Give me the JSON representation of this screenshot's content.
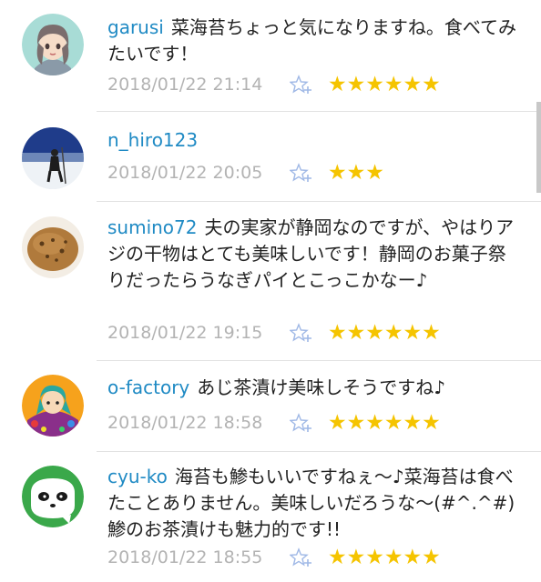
{
  "comments": [
    {
      "username": "garusi",
      "text": "菜海苔ちょっと気になりますね。食べてみたいです！",
      "timestamp": "2018/01/22 21:14",
      "stars": "★★★★★★",
      "avatar_icon": "anime-girl-avatar-icon"
    },
    {
      "username": "n_hiro123",
      "text": "",
      "timestamp": "2018/01/22 20:05",
      "stars": "★★★",
      "avatar_icon": "snow-hiker-avatar-icon"
    },
    {
      "username": "sumino72",
      "text": "夫の実家が静岡なのですが、やはりアジの干物はとても美味しいです！静岡のお菓子祭りだったらうなぎパイとこっこかなー♪",
      "timestamp": "2018/01/22 19:15",
      "stars": "★★★★★★",
      "avatar_icon": "potato-avatar-icon"
    },
    {
      "username": "o-factory",
      "text": "あじ茶漬け美味しそうですね♪",
      "timestamp": "2018/01/22 18:58",
      "stars": "★★★★★★",
      "avatar_icon": "illustration-avatar-icon"
    },
    {
      "username": "cyu-ko",
      "text": "海苔も鯵もいいですねぇ～♪菜海苔は食べたことありません。美味しいだろうな～(#^.^#)　鯵のお茶漬けも魅力的です!!",
      "timestamp": "2018/01/22 18:55",
      "stars": "★★★★★★",
      "avatar_icon": "panda-avatar-icon"
    }
  ],
  "colors": {
    "username": "#1f8ac4",
    "star": "#f5c400",
    "timestamp": "#b3b3b3",
    "fav_icon": "#9fb8e6"
  }
}
